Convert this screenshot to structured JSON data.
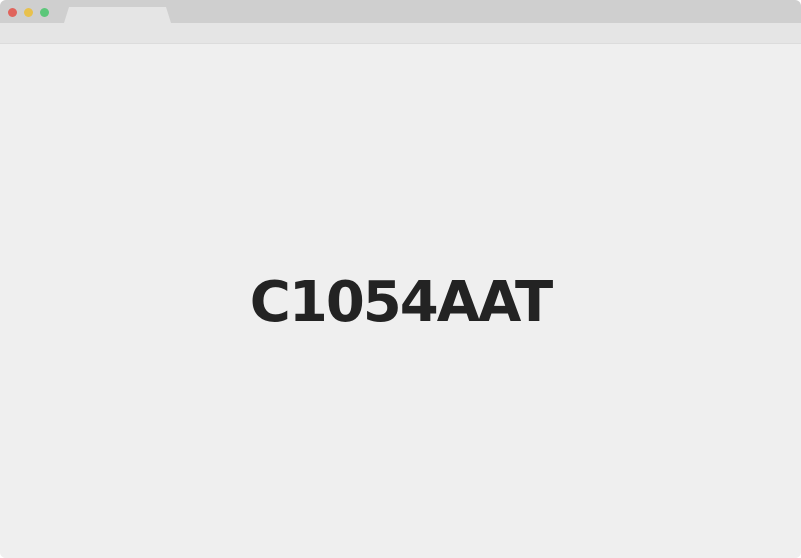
{
  "window": {
    "controls": {
      "close_color": "#e0645c",
      "minimize_color": "#e8c14d",
      "maximize_color": "#5cc77a"
    }
  },
  "content": {
    "text": "C1054AAT"
  }
}
